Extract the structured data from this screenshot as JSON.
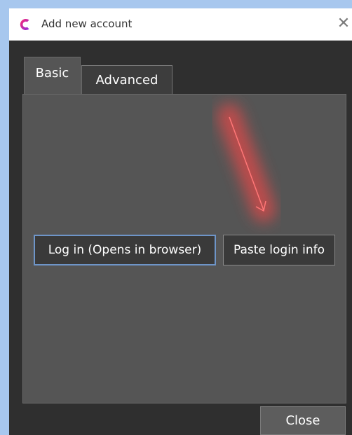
{
  "window": {
    "title": "Add new account",
    "close_glyph": "✕",
    "app_icon": "c-logo-icon",
    "brand_colors": [
      "#ff2d6f",
      "#8a2be2"
    ]
  },
  "tabs": [
    {
      "label": "Basic",
      "selected": true
    },
    {
      "label": "Advanced",
      "selected": false
    }
  ],
  "basic_tab": {
    "login_button": "Log in (Opens in browser)",
    "paste_button": "Paste login info"
  },
  "footer": {
    "close_button": "Close"
  },
  "annotation": {
    "type": "red-arrow",
    "color": "#ff3b3b"
  }
}
